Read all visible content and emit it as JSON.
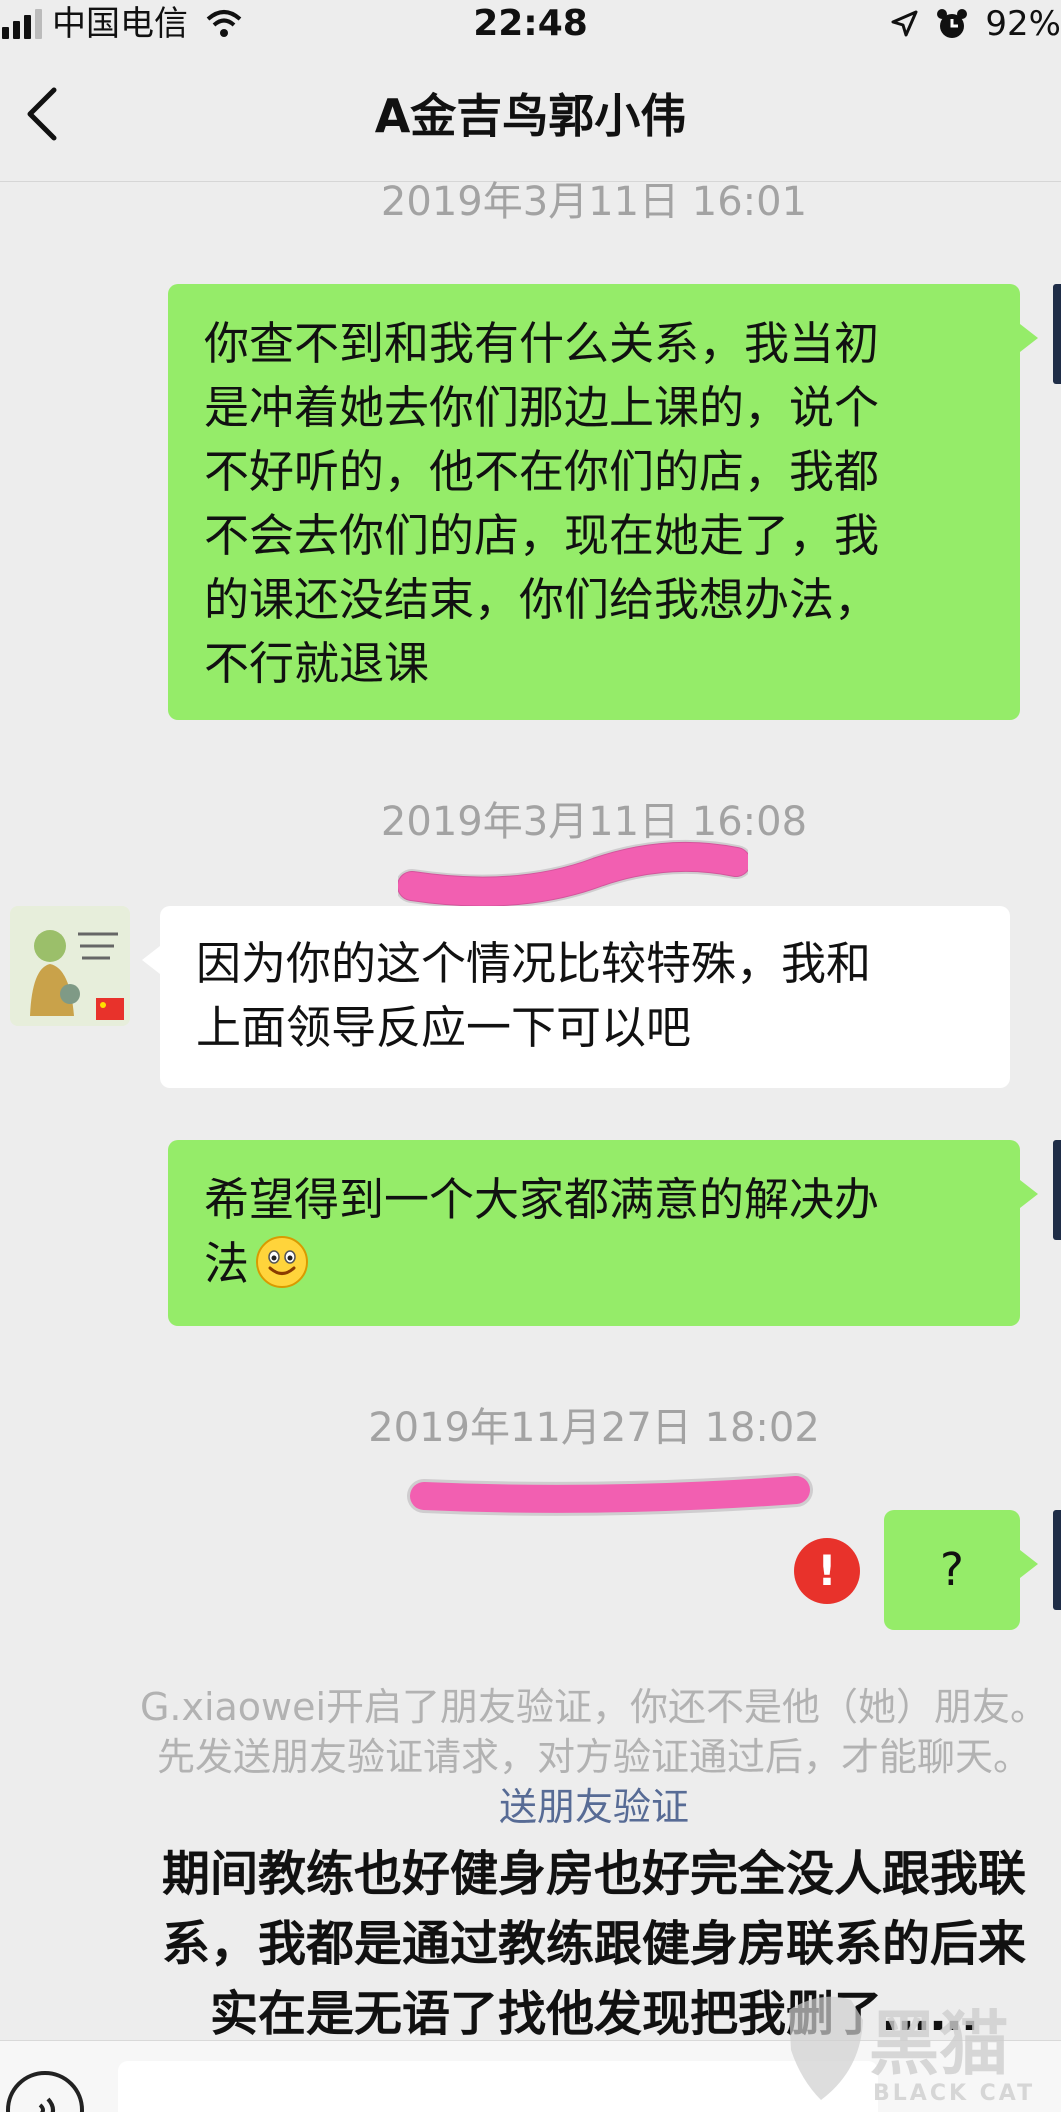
{
  "status_bar": {
    "carrier": "中国电信",
    "time": "22:48",
    "battery": "92%"
  },
  "nav": {
    "title": "A金吉鸟郭小伟"
  },
  "messages": [
    {
      "type": "timestamp",
      "text": "2019年3月11日 16:01"
    },
    {
      "type": "sent",
      "lines": [
        "你查不到和我有什么关系，我当初",
        "是冲着她去你们那边上课的，说个",
        "不好听的，他不在你们的店，我都",
        "不会去你们的店，现在她走了，我",
        "的课还没结束，你们给我想办法，",
        "不行就退课"
      ]
    },
    {
      "type": "timestamp",
      "text": "2019年3月11日 16:08"
    },
    {
      "type": "received",
      "lines": [
        "因为你的这个情况比较特殊，我和",
        "上面领导反应一下可以吧"
      ]
    },
    {
      "type": "sent",
      "lines": [
        "希望得到一个大家都满意的解决办",
        "法"
      ]
    },
    {
      "type": "timestamp",
      "text": "2019年11月27日 18:02"
    },
    {
      "type": "sent",
      "text": "?",
      "status": "failed"
    }
  ],
  "system_notice": {
    "line1": "G.xiaowei开启了朋友验证，你还不是他（她）朋友。",
    "line2": "先发送朋友验证请求，对方验证通过后，才能聊天。",
    "link": "送朋友验证"
  },
  "overlay_caption": {
    "line1": "期间教练也好健身房也好完全没人跟我联",
    "line2": "系，我都是通过教练跟健身房联系的后来",
    "line3": "实在是无语了找他发现把我删了……"
  },
  "watermark": {
    "text_cn": "黑猫",
    "text_en": "BLACK CAT"
  },
  "icons": {
    "back": "chevron-left-icon",
    "emoji": "smiley-icon",
    "error": "exclamation-circle-icon",
    "voice": "voice-icon"
  },
  "colors": {
    "background": "#ededed",
    "sent_bubble": "#95ec69",
    "received_bubble": "#ffffff",
    "error_red": "#e8322b",
    "link_blue": "#576b95",
    "highlighter_pink": "#f25fb1"
  }
}
